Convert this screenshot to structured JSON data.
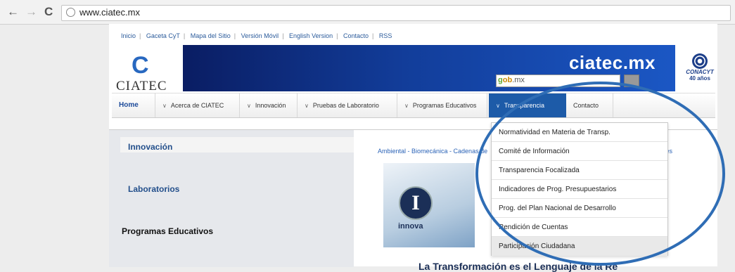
{
  "browser": {
    "back": "←",
    "forward": "→",
    "reload": "C",
    "url": "www.ciatec.mx"
  },
  "top_links": [
    "Inicio",
    "Gaceta CyT",
    "Mapa del Sitio",
    "Versión Móvil",
    "English Version",
    "Contacto",
    "RSS"
  ],
  "banner": {
    "logo_text": "CIATEC",
    "logo_mark": "C",
    "site_name": "ciatec.mx",
    "search_placeholder_a": "g",
    "search_placeholder_b": "ob",
    "search_placeholder_c": ".mx",
    "conacyt_name": "CONACYT",
    "conacyt_years": "40 años"
  },
  "nav": {
    "home": "Home",
    "acerca": "Acerca de CIATEC",
    "innovacion": "Innovación",
    "pruebas": "Pruebas de Laboratorio",
    "programas": "Programas Educativos",
    "transparencia": "Transparencia",
    "contacto": "Contacto",
    "chevron": "∨"
  },
  "left_menu": {
    "innovacion": "Innovación",
    "laboratorios": "Laboratorios",
    "programas": "Programas Educativos"
  },
  "tags": {
    "text": "Ambiental - Biomecánica - Cadenas de",
    "end": "teriales"
  },
  "hero": {
    "badge_letter": "I",
    "badge_label": "innova",
    "bottom_text": "La Transformación es el Lenguaje de la Re"
  },
  "dropdown": {
    "items": [
      "Normatividad en Materia de Transp.",
      "Comité de Información",
      "Transparencia Focalizada",
      "Indicadores de Prog. Presupuestarios",
      "Prog. del Plan Nacional de Desarrollo",
      "Rendición de Cuentas",
      "Participación Ciudadana"
    ]
  },
  "colors": {
    "accent": "#1d5ba8",
    "annotation": "#2f6db5"
  }
}
